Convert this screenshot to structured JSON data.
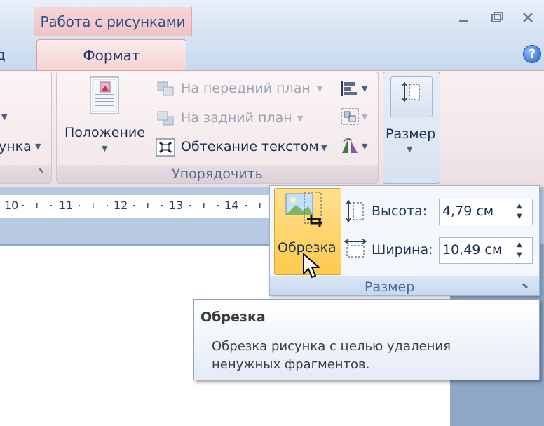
{
  "window": {
    "context_tab_title": "Работа с рисунками",
    "minimize_icon": "minimize-icon",
    "restore_icon": "restore-icon",
    "close_icon": "close-icon"
  },
  "tabs": {
    "partial_prev": "д",
    "active": "Формат",
    "help_label": "?"
  },
  "ribbon": {
    "partial_group_text": "унка",
    "arrange": {
      "position_label": "Положение",
      "bring_front": "На передний план",
      "send_back": "На задний план",
      "text_wrap": "Обтекание текстом",
      "group_label": "Упорядочить"
    },
    "size": {
      "label": "Размер"
    }
  },
  "ruler": {
    "numbers": [
      "10",
      "11",
      "12",
      "13",
      "14"
    ]
  },
  "size_popup": {
    "crop_label": "Обрезка",
    "height_label": "Высота:",
    "height_value": "4,79 см",
    "width_label": "Ширина:",
    "width_value": "10,49 см",
    "group_label": "Размер"
  },
  "tooltip": {
    "title": "Обрезка",
    "body_line1": "Обрезка рисунка с целью удаления",
    "body_line2": "ненужных фрагментов."
  }
}
